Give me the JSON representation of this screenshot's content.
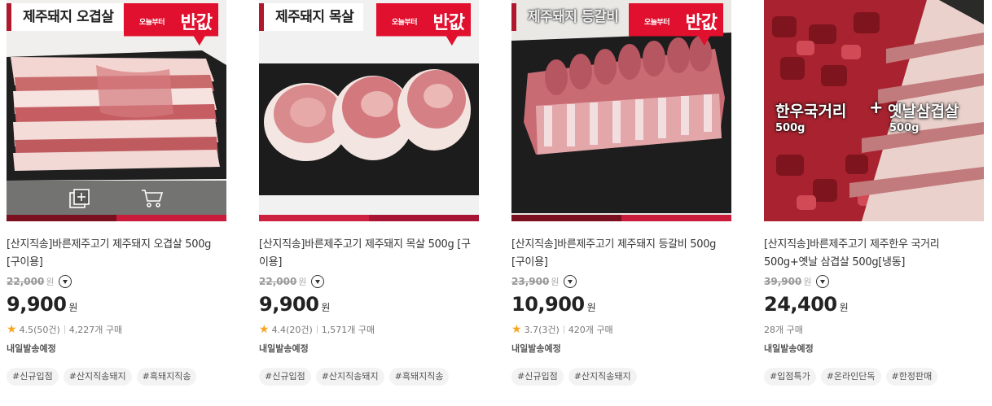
{
  "products": [
    {
      "image_label": "제주돼지 오겹살",
      "badge_small": "오늘부터",
      "badge_big": "반값",
      "name": "[산지직송]바른제주고기 제주돼지 오겹살 500g [구이용]",
      "original_price": "22,000",
      "original_unit": "원",
      "price": "9,900",
      "price_unit": "원",
      "rating": "4.5",
      "reviews": "(50건)",
      "purchases": "4,227개 구매",
      "shipping": "내일발송예정",
      "tags": [
        "#신규입점",
        "#산지직송돼지",
        "#흑돼지직송"
      ]
    },
    {
      "image_label": "제주돼지 목살",
      "badge_small": "오늘부터",
      "badge_big": "반값",
      "name": "[산지직송]바른제주고기 제주돼지 목살 500g [구이용]",
      "original_price": "22,000",
      "original_unit": "원",
      "price": "9,900",
      "price_unit": "원",
      "rating": "4.4",
      "reviews": "(20건)",
      "purchases": "1,571개 구매",
      "shipping": "내일발송예정",
      "tags": [
        "#신규입점",
        "#산지직송돼지",
        "#흑돼지직송"
      ]
    },
    {
      "image_label": "제주돼지 등갈비",
      "badge_small": "오늘부터",
      "badge_big": "반값",
      "name": "[산지직송]바른제주고기 제주돼지 등갈비 500g [구이용]",
      "original_price": "23,900",
      "original_unit": "원",
      "price": "10,900",
      "price_unit": "원",
      "rating": "3.7",
      "reviews": "(3건)",
      "purchases": "420개 구매",
      "shipping": "내일발송예정",
      "tags": [
        "#신규입점",
        "#산지직송돼지"
      ]
    },
    {
      "image_text_left": "한우국거리",
      "image_text_plus": "+",
      "image_text_right": "옛날삼겹살",
      "image_weight_left": "500g",
      "image_weight_right": "500g",
      "name": "[산지직송]바른제주고기 제주한우 국거리 500g+옛날 삼겹살 500g[냉동]",
      "original_price": "39,900",
      "original_unit": "원",
      "price": "24,400",
      "price_unit": "원",
      "purchases": "28개 구매",
      "shipping": "내일발송예정",
      "tags": [
        "#입점특가",
        "#온라인단독",
        "#한정판매"
      ]
    }
  ],
  "colors": {
    "accent": "#e0102e",
    "brand_dark": "#7a0f1f",
    "star": "#f5a623"
  },
  "icons": {
    "add": "add-to-list-icon",
    "cart": "cart-icon",
    "dropdown": "chevron-down-icon",
    "star": "star-icon"
  }
}
